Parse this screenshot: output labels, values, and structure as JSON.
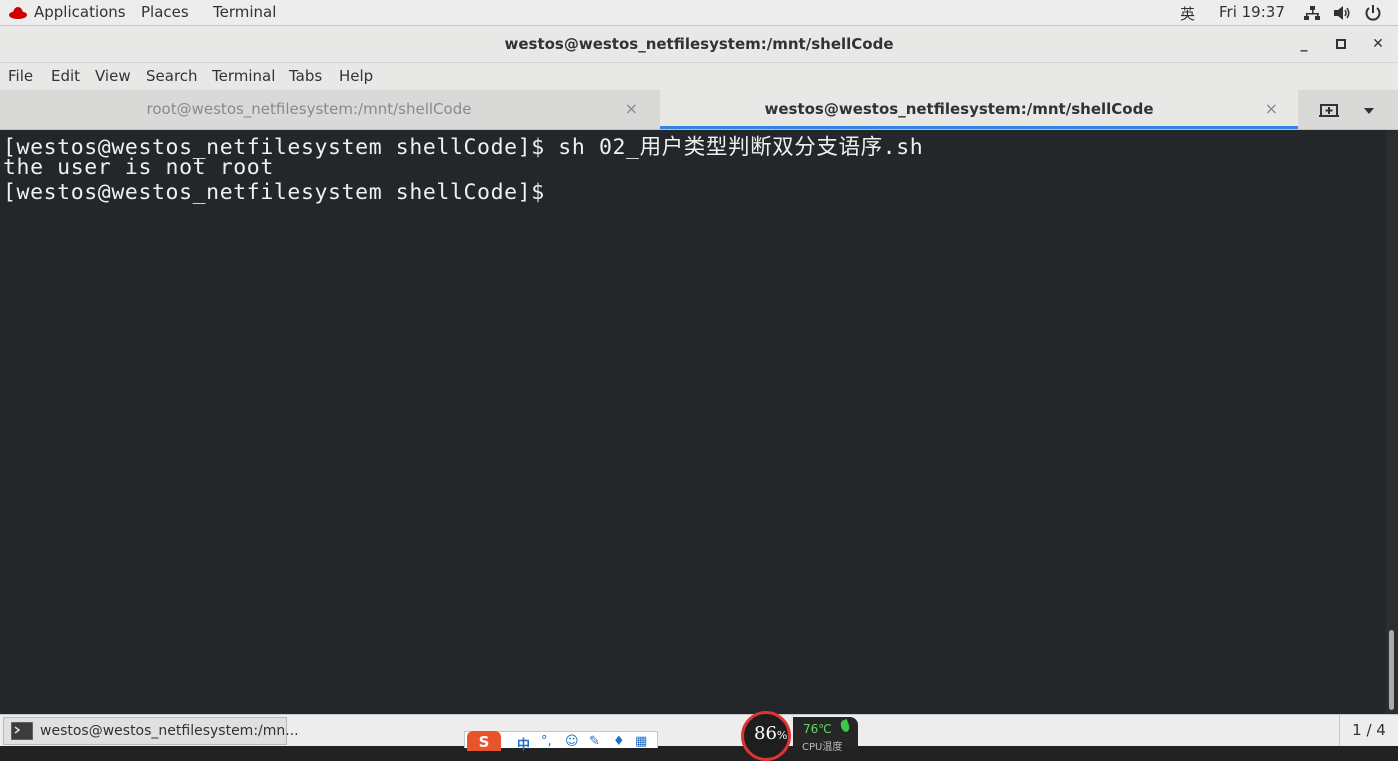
{
  "topbar": {
    "applications": "Applications",
    "places": "Places",
    "terminal": "Terminal",
    "input_method": "英",
    "clock": "Fri 19:37"
  },
  "window": {
    "title": "westos@westos_netfilesystem:/mnt/shellCode",
    "minimize": "_",
    "maximize": "▫",
    "close": "✕"
  },
  "menu": [
    "File",
    "Edit",
    "View",
    "Search",
    "Terminal",
    "Tabs",
    "Help"
  ],
  "tabs": [
    {
      "label": "root@westos_netfilesystem:/mnt/shellCode",
      "close": "×",
      "active": false
    },
    {
      "label": "westos@westos_netfilesystem:/mnt/shellCode",
      "close": "×",
      "active": true
    }
  ],
  "terminal": {
    "lines": [
      "[westos@westos_netfilesystem shellCode]$ sh 02_用户类型判断双分支语序.sh",
      "the user is not root",
      "[westos@westos_netfilesystem shellCode]$ "
    ]
  },
  "taskbar": {
    "window_item": "westos@westos_netfilesystem:/mn...",
    "pager": "1 / 4"
  },
  "ime_toolbar": {
    "logo": "S",
    "lang": "中"
  },
  "cpu_widget": {
    "usage_percent": "86",
    "percent_sign": "%",
    "temperature": "76℃",
    "label": "CPU温度"
  },
  "colors": {
    "terminal_bg": "#232729",
    "accent": "#3584e4",
    "cpu_ring": "#dd3333",
    "temp_green": "#5fdc5f"
  },
  "icons": [
    "redhat-icon",
    "network-icon",
    "volume-icon",
    "power-icon",
    "new-tab-icon",
    "tab-menu-icon",
    "terminal-app-icon",
    "leaf-icon"
  ]
}
